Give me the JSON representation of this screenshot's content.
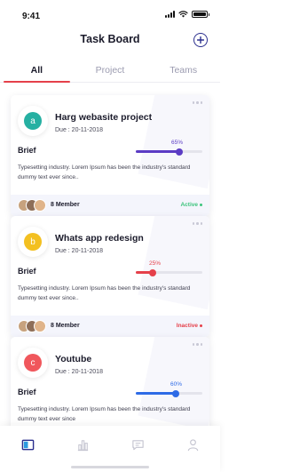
{
  "status_bar": {
    "time": "9:41"
  },
  "header": {
    "title": "Task Board",
    "add_icon": "plus-circle-icon"
  },
  "tabs": [
    {
      "label": "All",
      "active": true
    },
    {
      "label": "Project",
      "active": false
    },
    {
      "label": "Teams",
      "active": false
    }
  ],
  "cards": [
    {
      "letter": "a",
      "letter_color": "#26b0a2",
      "title": "Harg webasite project",
      "due": "Due : 20-11-2018",
      "brief_label": "Brief",
      "progress_label": "65%",
      "progress_value": 0.65,
      "progress_color": "#5b3cc4",
      "description": "Typesetting industry. Lorem Ipsum has been the industry's standard dummy text ever since..",
      "members": "8 Member",
      "status": "Active",
      "status_color": "#3cc47c"
    },
    {
      "letter": "b",
      "letter_color": "#f3c021",
      "title": "Whats app redesign",
      "due": "Due : 20-11-2018",
      "brief_label": "Brief",
      "progress_label": "25%",
      "progress_value": 0.25,
      "progress_color": "#e5404a",
      "description": "Typesetting industry. Lorem Ipsum has been the industry's standard dummy text ever since..",
      "members": "8 Member",
      "status": "Inactive",
      "status_color": "#e5404a"
    },
    {
      "letter": "c",
      "letter_color": "#f0575c",
      "title": "Youtube",
      "due": "Due : 20-11-2018",
      "brief_label": "Brief",
      "progress_label": "60%",
      "progress_value": 0.6,
      "progress_color": "#2e6be6",
      "description": "Typesetting industry. Lorem Ipsum has been the industry's standard dummy text ever since",
      "members": "",
      "status": "",
      "status_color": ""
    }
  ],
  "bottom_nav": [
    {
      "icon": "board-icon",
      "active": true
    },
    {
      "icon": "chart-icon",
      "active": false
    },
    {
      "icon": "chat-icon",
      "active": false
    },
    {
      "icon": "profile-icon",
      "active": false
    }
  ]
}
